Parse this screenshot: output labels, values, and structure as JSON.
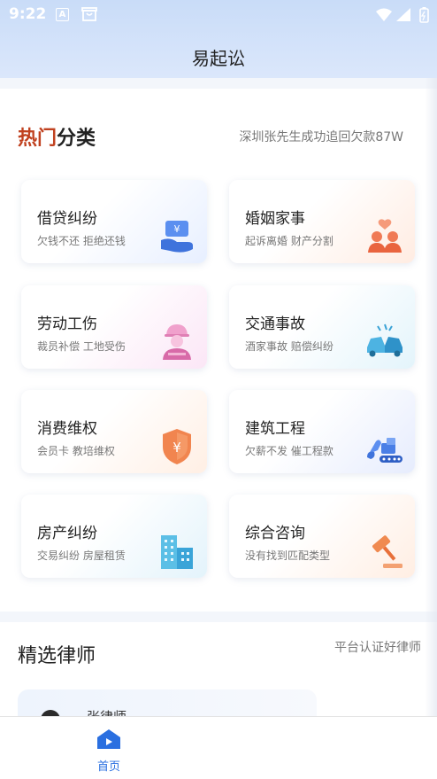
{
  "status_bar": {
    "time": "9:22",
    "a_icon_letter": "A"
  },
  "header": {
    "title": "易起讼"
  },
  "categories": {
    "title_highlight": "热门",
    "title_rest": "分类",
    "subtitle": "深圳张先生成功追回欠款87W",
    "items": [
      {
        "title": "借贷纠纷",
        "desc": "欠钱不还 拒绝还钱",
        "icon": "loan-icon"
      },
      {
        "title": "婚姻家事",
        "desc": "起诉离婚 财产分割",
        "icon": "family-icon"
      },
      {
        "title": "劳动工伤",
        "desc": "裁员补偿 工地受伤",
        "icon": "worker-icon"
      },
      {
        "title": "交通事故",
        "desc": "酒家事故 赔偿纠纷",
        "icon": "car-accident-icon"
      },
      {
        "title": "消费维权",
        "desc": "会员卡 教培维权",
        "icon": "shield-yuan-icon"
      },
      {
        "title": "建筑工程",
        "desc": "欠薪不发 催工程款",
        "icon": "excavator-icon"
      },
      {
        "title": "房产纠纷",
        "desc": "交易纠纷 房屋租赁",
        "icon": "building-icon"
      },
      {
        "title": "综合咨询",
        "desc": "没有找到匹配类型",
        "icon": "gavel-icon"
      }
    ]
  },
  "lawyers": {
    "title": "精选律师",
    "subtitle": "平台认证好律师",
    "first_name": "张律师"
  },
  "tabbar": {
    "home_label": "首页"
  },
  "colors": {
    "accent": "#2a6fe0",
    "title_highlight": "#c0411f"
  }
}
